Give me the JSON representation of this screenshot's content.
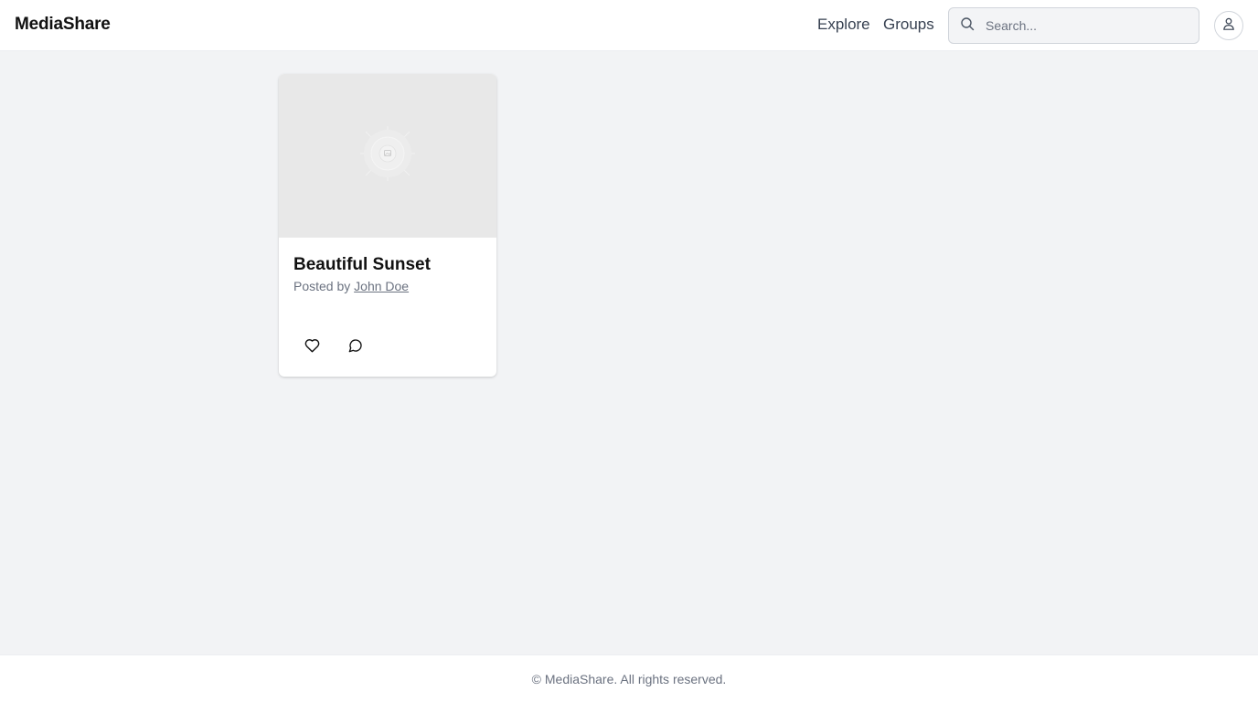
{
  "header": {
    "logo": "MediaShare",
    "nav": [
      {
        "label": "Explore"
      },
      {
        "label": "Groups"
      }
    ],
    "search": {
      "placeholder": "Search...",
      "value": "",
      "icon": "search-icon"
    },
    "avatar_icon": "user-icon"
  },
  "posts": [
    {
      "title": "Beautiful Sunset",
      "byline_prefix": "Posted by ",
      "author": "John Doe",
      "media_icon": "image-placeholder-icon",
      "actions": [
        {
          "icon": "heart-icon"
        },
        {
          "icon": "comment-icon"
        }
      ]
    }
  ],
  "footer": {
    "text": "© MediaShare. All rights reserved."
  },
  "colors": {
    "background": "#f2f3f5",
    "surface": "#ffffff",
    "media_placeholder": "#e8e8e8",
    "text_primary": "#111111",
    "text_muted": "#6b7280"
  }
}
